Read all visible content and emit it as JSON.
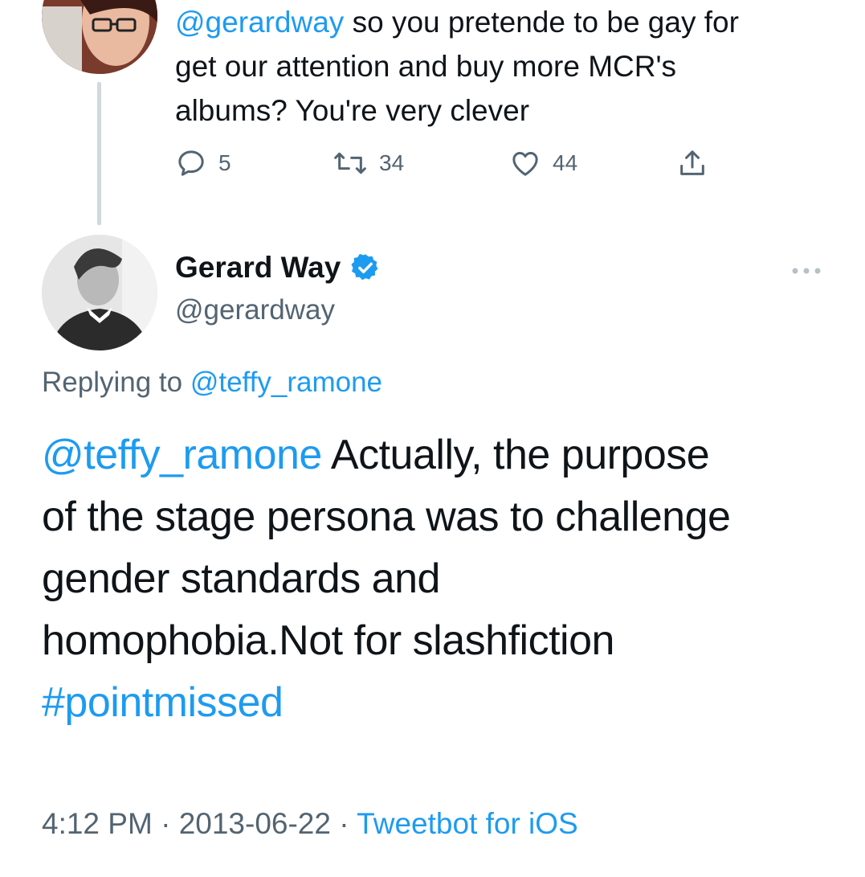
{
  "reply_tweet": {
    "mention": "@gerardway",
    "text_line1": " so you pretende to be gay for",
    "text_line2": "get our attention and buy more MCR's",
    "text_line3": "albums? You're very clever",
    "replies": "5",
    "retweets": "34",
    "likes": "44"
  },
  "main_tweet": {
    "display_name": "Gerard Way",
    "handle": "@gerardway",
    "replying_prefix": "Replying to ",
    "replying_to": "@teffy_ramone",
    "mention": "@teffy_ramone",
    "text_line1": " Actually, the purpose",
    "text_line2": "of the stage persona was to challenge",
    "text_line3": "gender standards and",
    "text_line4": "homophobia.Not for slashfiction",
    "hashtag": "#pointmissed",
    "time": "4:12 PM",
    "separator": " · ",
    "date": "2013-06-22",
    "source": "Tweetbot for iOS"
  },
  "colors": {
    "link": "#1d9bf0",
    "secondary_text": "#536471",
    "primary_text": "#0f1419",
    "thread_line": "#cfd9de"
  },
  "icons": {
    "reply": "reply-icon",
    "retweet": "retweet-icon",
    "like": "heart-icon",
    "share": "share-icon",
    "verified": "verified-badge-icon",
    "more": "more-options-icon"
  }
}
